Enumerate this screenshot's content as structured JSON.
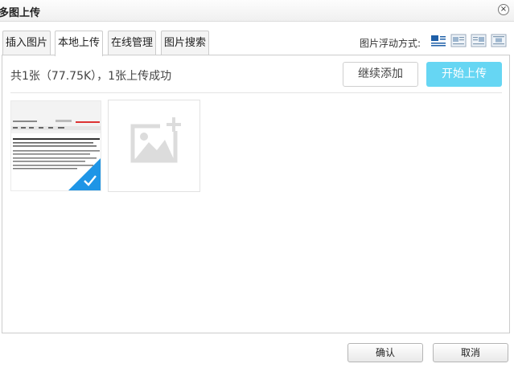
{
  "dialog": {
    "title": "多图上传",
    "close_glyph": "×"
  },
  "tabs": [
    {
      "label": "插入图片"
    },
    {
      "label": "本地上传"
    },
    {
      "label": "在线管理"
    },
    {
      "label": "图片搜索"
    }
  ],
  "float_option": {
    "label": "图片浮动方式:",
    "icons": [
      "align-none-icon",
      "align-left-icon",
      "align-right-icon",
      "align-center-icon"
    ],
    "selected": "align-none-icon"
  },
  "upload": {
    "status_text": "共1张（77.75K），1张上传成功",
    "continue_label": "继续添加",
    "start_label": "开始上传",
    "files": [
      {
        "uploaded": true
      }
    ],
    "add_icon": "add-image-icon"
  },
  "footer": {
    "ok_label": "确认",
    "cancel_label": "取消"
  },
  "colors": {
    "accent": "#1e95e6",
    "start_button": "#66d6f3",
    "border": "#cccccc"
  }
}
